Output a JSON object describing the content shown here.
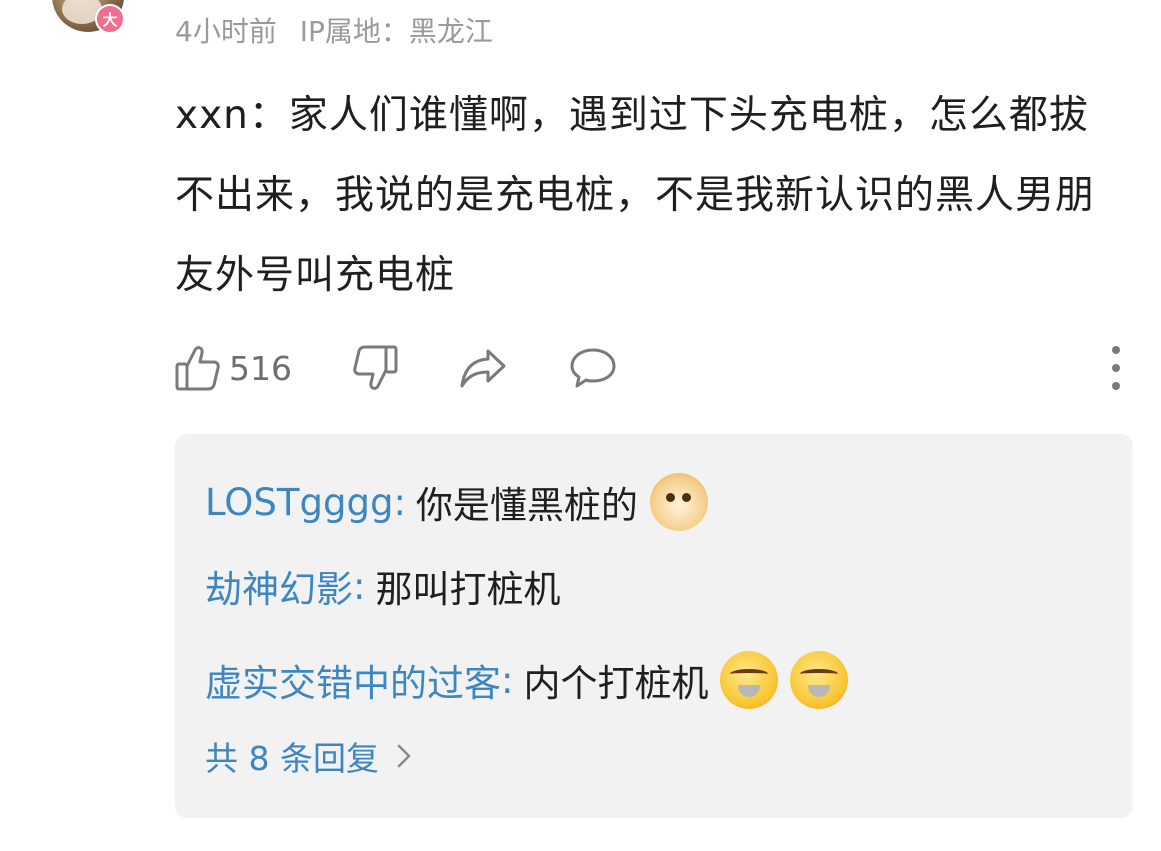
{
  "comment": {
    "avatar_badge": "大",
    "meta_time": "4小时前",
    "meta_ip": "IP属地：黑龙江",
    "text": "xxn：家人们谁懂啊，遇到过下头充电桩，怎么都拔不出来，我说的是充电桩，不是我新认识的黑人男朋友外号叫充电桩",
    "like_count": "516"
  },
  "icons": {
    "like": "thumbs-up-icon",
    "dislike": "thumbs-down-icon",
    "share": "share-icon",
    "comment": "comment-icon",
    "more": "more-vertical-icon"
  },
  "replies": [
    {
      "user": "LOSTgggg",
      "content": "你是懂黑桩的",
      "emoji": [
        "doge"
      ]
    },
    {
      "user": "劫神幻影",
      "content": "那叫打桩机",
      "emoji": []
    },
    {
      "user": "虚实交错中的过客",
      "content": "内个打桩机",
      "emoji": [
        "grin",
        "grin"
      ]
    }
  ],
  "reply_colon": ":",
  "more_replies": "共 8 条回复",
  "colors": {
    "username": "#3c86c2",
    "badge": "#f06e8f",
    "reply_bg": "#f2f2f2",
    "meta": "#9a9a9a"
  }
}
